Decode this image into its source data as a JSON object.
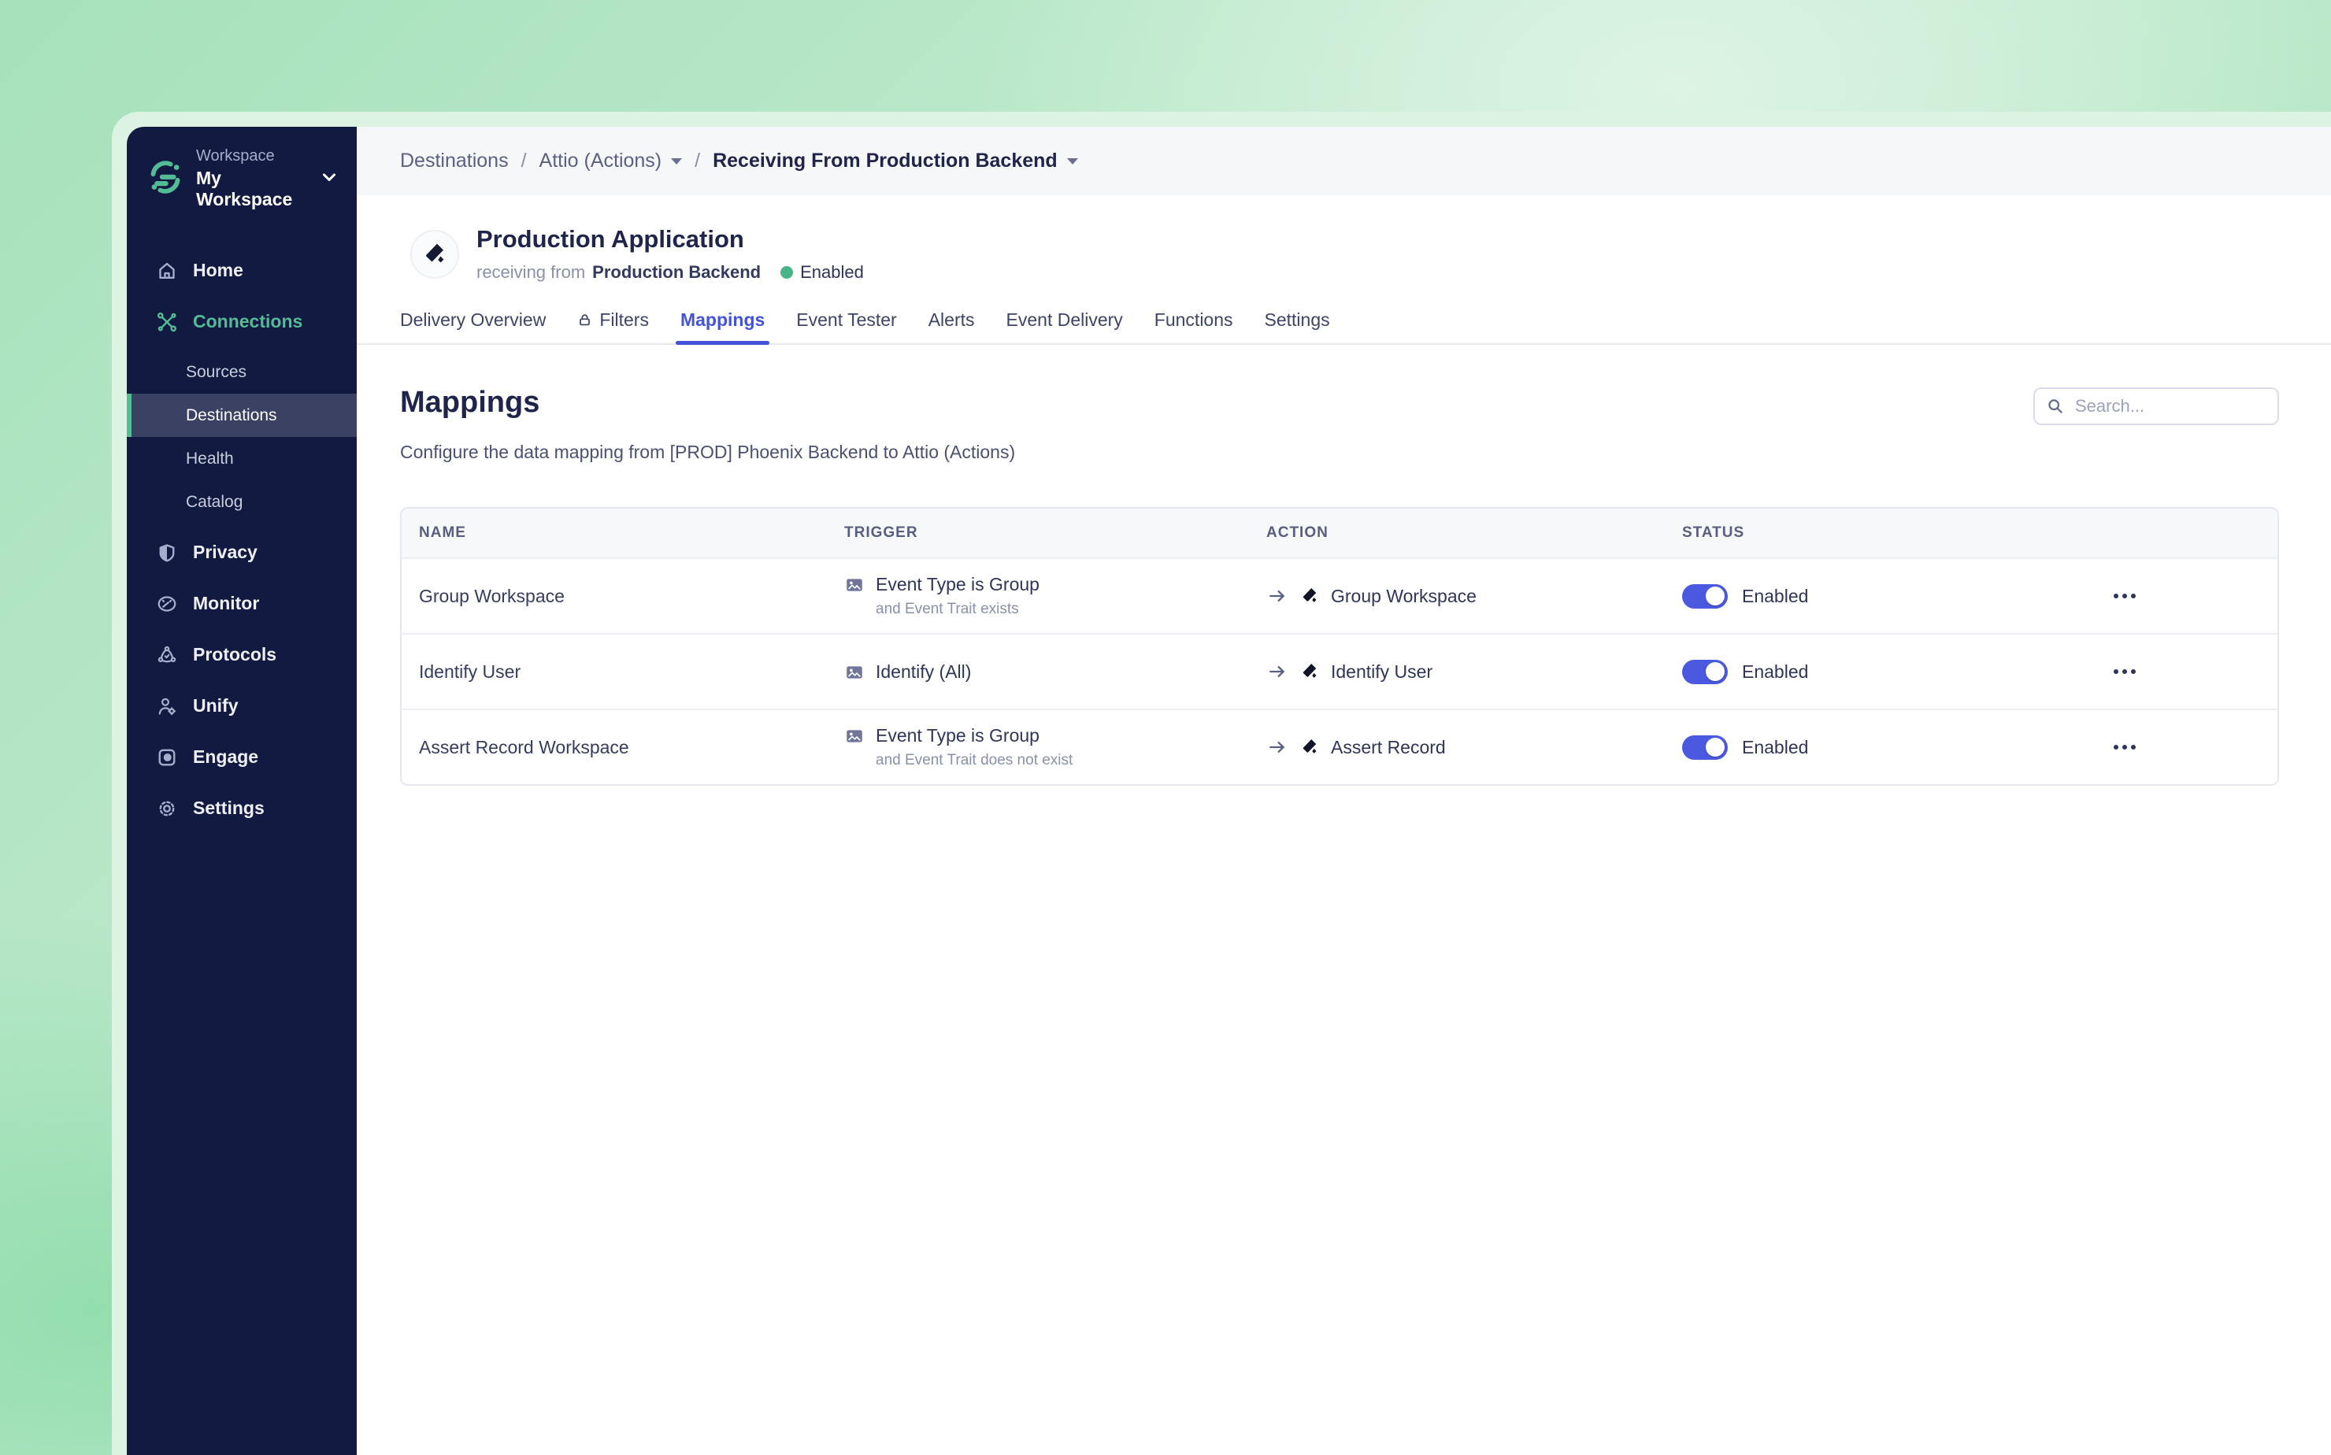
{
  "colors": {
    "background_mint": "#A6E1BB",
    "sidebar_bg": "#131A41",
    "accent_green": "#52BD95",
    "active_tab_blue": "#4452D8",
    "toggle_on_blue": "#4B59E0",
    "status_dot_green": "#47B586"
  },
  "sidebar": {
    "logo_icon": "segment-logo",
    "workspace_label": "Workspace",
    "workspace_name": "My Workspace",
    "chevron_icon": "chevron-down-icon",
    "items": [
      {
        "label": "Home",
        "icon": "home-icon",
        "active": false
      },
      {
        "label": "Connections",
        "icon": "connections-icon",
        "active": true
      },
      {
        "label": "Privacy",
        "icon": "shield-icon",
        "active": false
      },
      {
        "label": "Monitor",
        "icon": "gauge-icon",
        "active": false
      },
      {
        "label": "Protocols",
        "icon": "protocols-icon",
        "active": false
      },
      {
        "label": "Unify",
        "icon": "person-icon",
        "active": false
      },
      {
        "label": "Engage",
        "icon": "engage-icon",
        "active": false
      },
      {
        "label": "Settings",
        "icon": "gear-icon",
        "active": false
      }
    ],
    "connections_subitems": [
      {
        "label": "Sources",
        "selected": false
      },
      {
        "label": "Destinations",
        "selected": true
      },
      {
        "label": "Health",
        "selected": false
      },
      {
        "label": "Catalog",
        "selected": false
      }
    ]
  },
  "breadcrumb": {
    "separator": "/",
    "items": [
      {
        "label": "Destinations",
        "current": false,
        "has_caret": false
      },
      {
        "label": "Attio (Actions)",
        "current": false,
        "has_caret": true
      },
      {
        "label": "Receiving From Production Backend",
        "current": true,
        "has_caret": true
      }
    ]
  },
  "header": {
    "app_icon": "attio-logo",
    "title": "Production Application",
    "subtitle_prefix": "receiving from",
    "source_name": "Production Backend",
    "status_label": "Enabled"
  },
  "tabs": {
    "items": [
      {
        "label": "Delivery Overview",
        "active": false,
        "locked": false
      },
      {
        "label": "Filters",
        "active": false,
        "locked": true
      },
      {
        "label": "Mappings",
        "active": true,
        "locked": false
      },
      {
        "label": "Event Tester",
        "active": false,
        "locked": false
      },
      {
        "label": "Alerts",
        "active": false,
        "locked": false
      },
      {
        "label": "Event Delivery",
        "active": false,
        "locked": false
      },
      {
        "label": "Functions",
        "active": false,
        "locked": false
      },
      {
        "label": "Settings",
        "active": false,
        "locked": false
      }
    ]
  },
  "content": {
    "title": "Mappings",
    "description": "Configure the data mapping from [PROD] Phoenix Backend to Attio (Actions)",
    "search_placeholder": "Search..."
  },
  "table": {
    "columns": [
      "NAME",
      "TRIGGER",
      "ACTION",
      "STATUS"
    ],
    "rows": [
      {
        "name": "Group Workspace",
        "trigger": {
          "icon": "event-icon",
          "main": "Event Type is Group",
          "sub": "and Event Trait exists"
        },
        "action": {
          "arrow_icon": "arrow-right-icon",
          "icon": "attio-icon",
          "label": "Group Workspace"
        },
        "status": {
          "enabled": true,
          "label": "Enabled"
        },
        "menu_icon": "ellipsis-icon"
      },
      {
        "name": "Identify User",
        "trigger": {
          "icon": "event-icon",
          "main": "Identify (All)",
          "sub": ""
        },
        "action": {
          "arrow_icon": "arrow-right-icon",
          "icon": "attio-icon",
          "label": "Identify User"
        },
        "status": {
          "enabled": true,
          "label": "Enabled"
        },
        "menu_icon": "ellipsis-icon"
      },
      {
        "name": "Assert Record Workspace",
        "trigger": {
          "icon": "event-icon",
          "main": "Event Type is Group",
          "sub": "and Event Trait does not exist"
        },
        "action": {
          "arrow_icon": "arrow-right-icon",
          "icon": "attio-icon",
          "label": "Assert Record"
        },
        "status": {
          "enabled": true,
          "label": "Enabled"
        },
        "menu_icon": "ellipsis-icon"
      }
    ]
  }
}
